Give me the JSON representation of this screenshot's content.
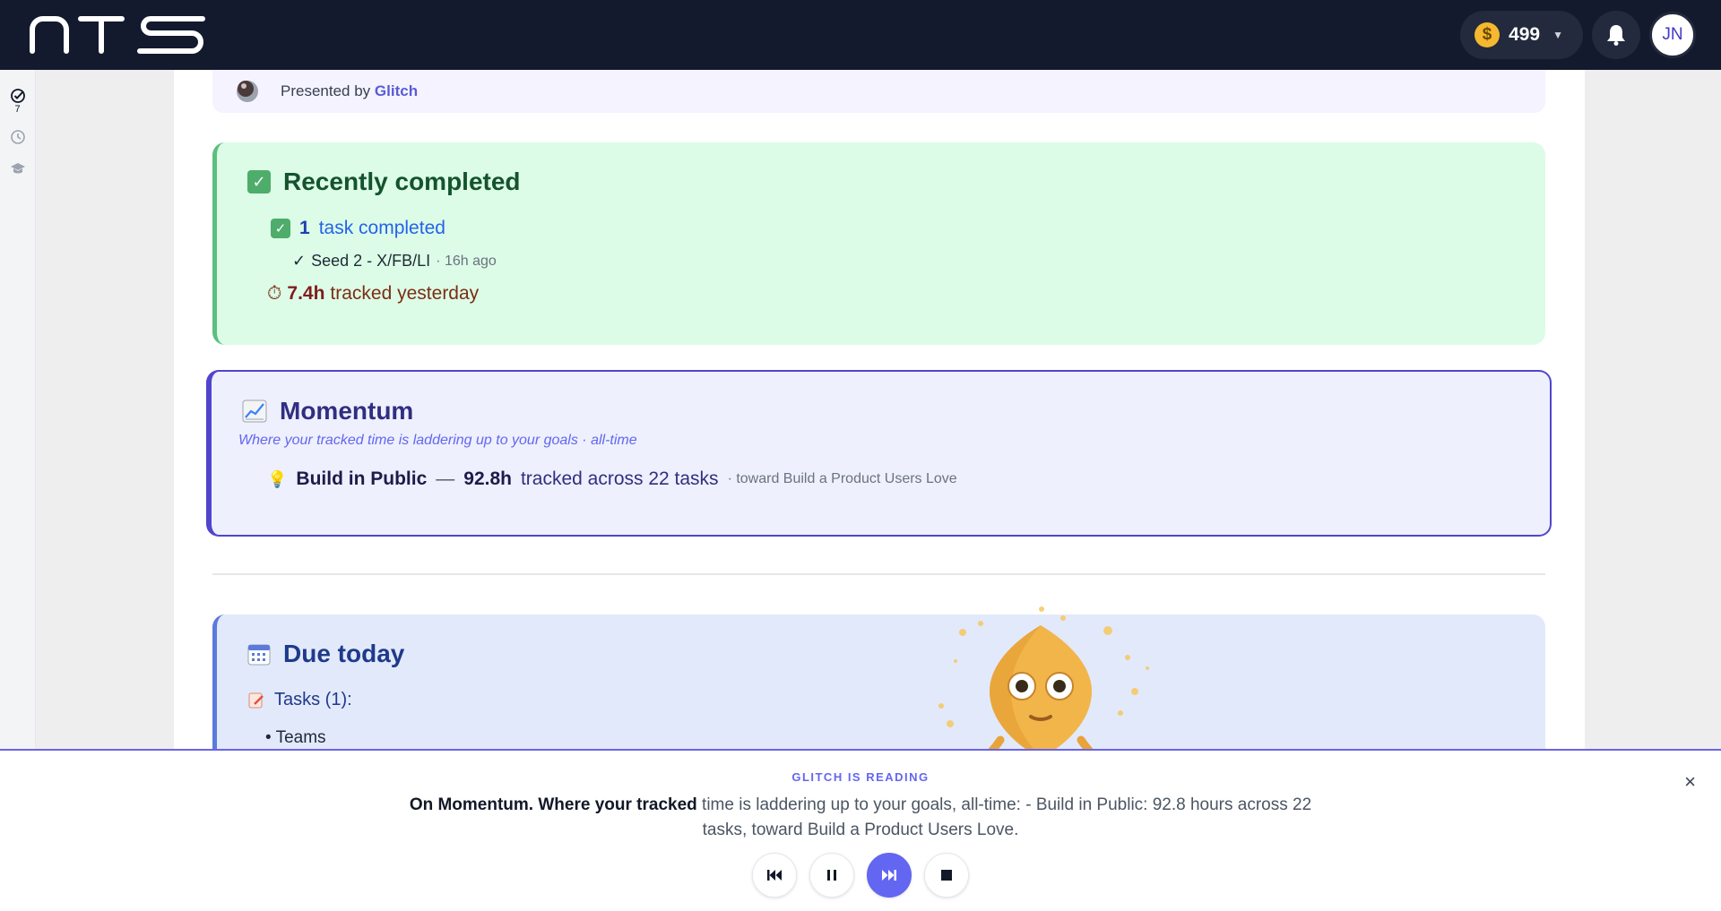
{
  "header": {
    "logo_text": "NTS",
    "coins": "499",
    "coin_symbol": "$",
    "avatar_initials": "JN"
  },
  "rail": {
    "tasks_count": "7"
  },
  "presented": {
    "prefix": "Presented by",
    "name": "Glitch"
  },
  "recent": {
    "title": "Recently completed",
    "count": "1",
    "count_label": "task completed",
    "task_check": "✓",
    "task_name": "Seed 2 - X/FB/LI",
    "task_ago": "· 16h ago",
    "timer_icon": "⏱",
    "tracked_hours": "7.4h",
    "tracked_label": "tracked yesterday"
  },
  "momentum": {
    "title": "Momentum",
    "subtitle": "Where your tracked time is laddering up to your goals · all-time",
    "bulb_icon": "💡",
    "goal": "Build in Public",
    "dash": "—",
    "hours": "92.8h",
    "tracked_label": "tracked across 22 tasks",
    "toward": "· toward Build a Product Users Love"
  },
  "due": {
    "title": "Due today",
    "tasks_label": "Tasks (1):",
    "item": "• Teams"
  },
  "reader": {
    "label": "GLITCH IS READING",
    "text_bold": "On Momentum. Where your tracked",
    "text_rest": " time is laddering up to your goals, all-time: - Build in Public: 92.8 hours across 22 tasks, toward Build a Product Users Love.",
    "close": "×"
  },
  "colors": {
    "topbar": "#141a2e",
    "accent": "#6366f1",
    "recent_bg": "#dcfce7",
    "momentum_bg": "#eef0fd",
    "due_bg": "#e2e9fb"
  },
  "icons": {
    "notification": "bell-icon",
    "previous": "skip-previous-icon",
    "pause": "pause-icon",
    "next": "skip-next-icon",
    "stop": "stop-icon"
  }
}
